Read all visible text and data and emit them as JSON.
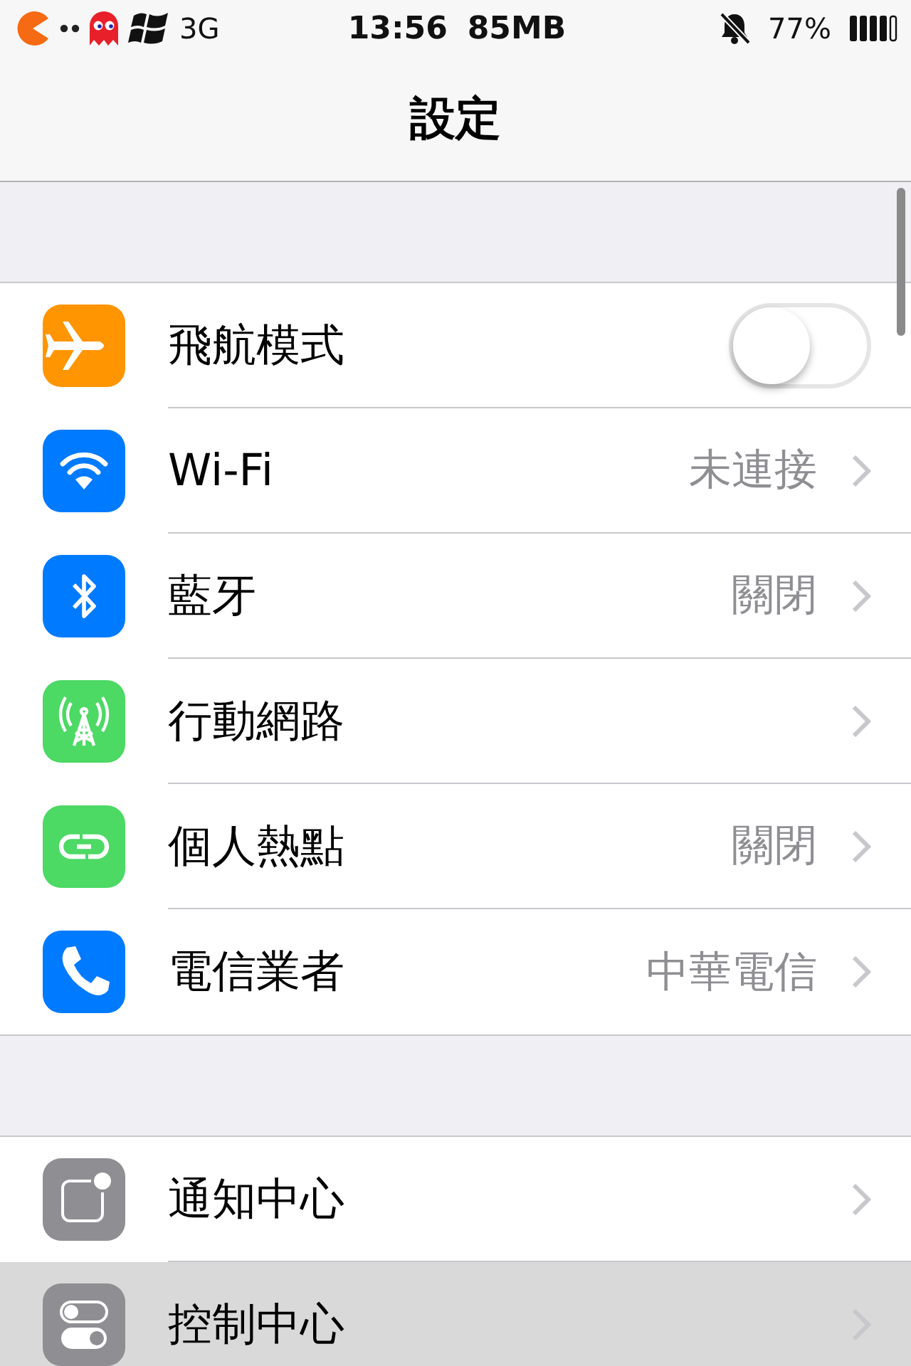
{
  "status_bar": {
    "network": "3G",
    "time": "13:56",
    "memory": "85MB",
    "battery": "77%"
  },
  "nav_bar": {
    "title": "設定"
  },
  "groups": [
    {
      "rows": [
        {
          "kind": "toggle",
          "label": "飛航模式",
          "color": "#ff9500",
          "on": false,
          "selected": false
        },
        {
          "kind": "link",
          "label": "Wi-Fi",
          "value": "未連接",
          "color": "#007aff",
          "selected": false
        },
        {
          "kind": "link",
          "label": "藍牙",
          "value": "關閉",
          "color": "#007aff",
          "selected": false
        },
        {
          "kind": "link",
          "label": "行動網路",
          "color": "#4cd964",
          "selected": false
        },
        {
          "kind": "link",
          "label": "個人熱點",
          "value": "關閉",
          "color": "#4cd964",
          "selected": false
        },
        {
          "kind": "link",
          "label": "電信業者",
          "value": "中華電信",
          "color": "#007aff",
          "selected": false
        }
      ]
    },
    {
      "rows": [
        {
          "kind": "link",
          "label": "通知中心",
          "color": "#8e8e93",
          "selected": false
        },
        {
          "kind": "link",
          "label": "控制中心",
          "color": "#8e8e93",
          "selected": true
        }
      ]
    }
  ]
}
